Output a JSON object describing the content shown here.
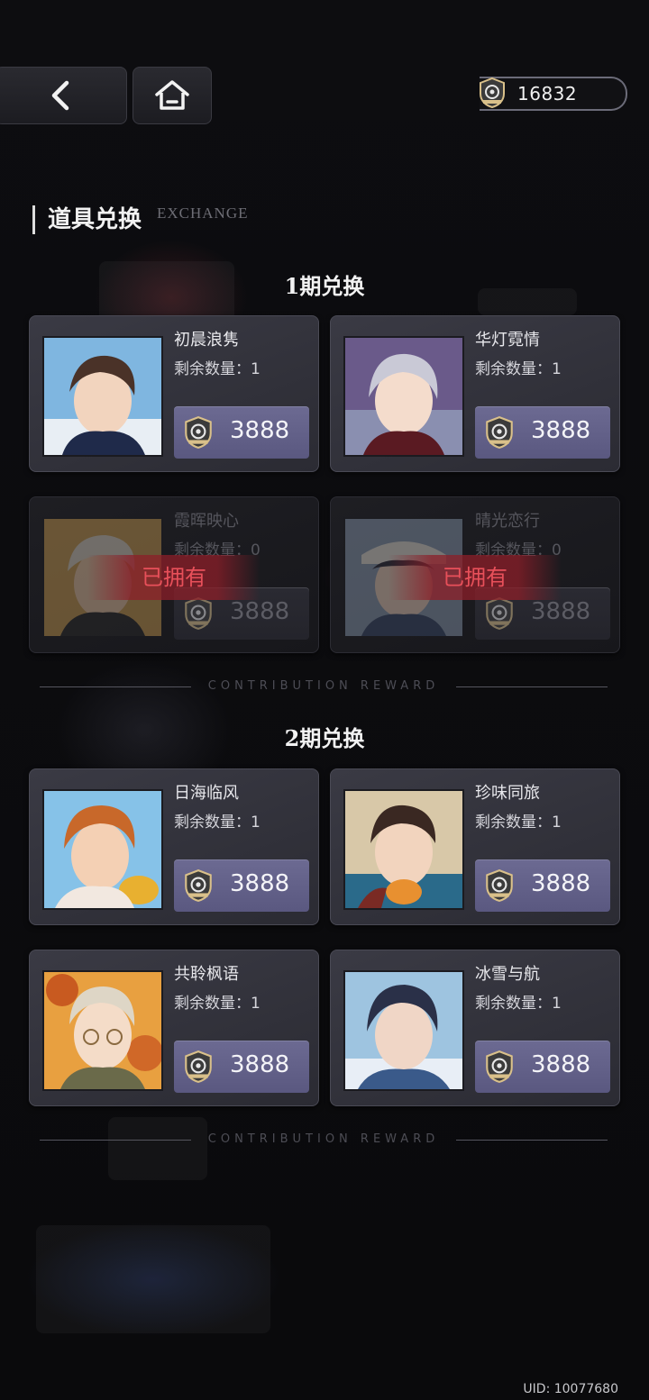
{
  "header": {
    "back_icon": "chevron-left-icon",
    "home_icon": "home-icon",
    "currency_icon": "emblem-badge-icon",
    "currency_value": "16832"
  },
  "section": {
    "title": "道具兑换",
    "subtitle": "EXCHANGE"
  },
  "periods": [
    {
      "title": "1期兑换",
      "items": [
        {
          "name": "初晨浪隽",
          "remaining": "剩余数量：1",
          "price": "3888",
          "owned": false,
          "owned_label": ""
        },
        {
          "name": "华灯霓情",
          "remaining": "剩余数量：1",
          "price": "3888",
          "owned": false,
          "owned_label": ""
        },
        {
          "name": "霞晖映心",
          "remaining": "剩余数量：0",
          "price": "3888",
          "owned": true,
          "owned_label": "已拥有"
        },
        {
          "name": "晴光恋行",
          "remaining": "剩余数量：0",
          "price": "3888",
          "owned": true,
          "owned_label": "已拥有"
        }
      ]
    },
    {
      "title": "2期兑换",
      "items": [
        {
          "name": "日海临风",
          "remaining": "剩余数量：1",
          "price": "3888",
          "owned": false
        },
        {
          "name": "珍味同旅",
          "remaining": "剩余数量：1",
          "price": "3888",
          "owned": false
        },
        {
          "name": "共聆枫语",
          "remaining": "剩余数量：1",
          "price": "3888",
          "owned": false
        },
        {
          "name": "冰雪与航",
          "remaining": "剩余数量：1",
          "price": "3888",
          "owned": false
        }
      ]
    }
  ],
  "divider_text": "CONTRIBUTION REWARD",
  "uid": "UID: 10077680",
  "colors": {
    "price_button": "#5f5d86",
    "owned_text": "#e8505a",
    "card_bg": "#33333c"
  }
}
